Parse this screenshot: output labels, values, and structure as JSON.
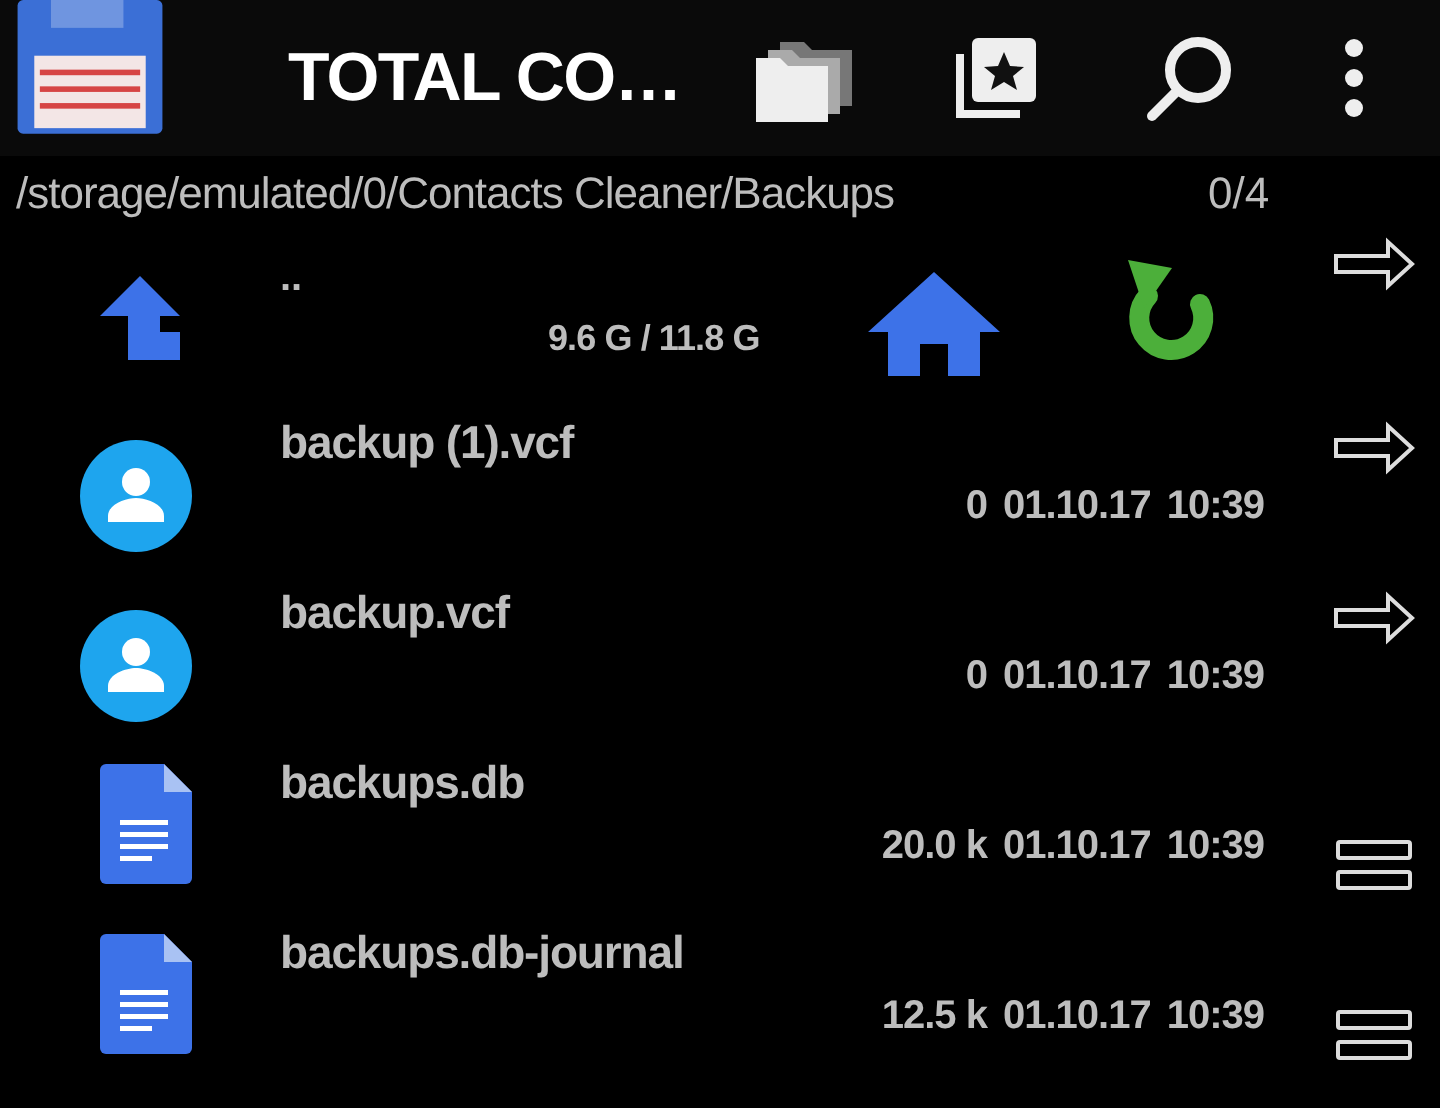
{
  "app_bar": {
    "title": "TOTAL CO…"
  },
  "path_bar": {
    "path": "/storage/emulated/0/Contacts Cleaner/Backups",
    "count": "0/4"
  },
  "parent_row": {
    "name": "..",
    "storage": "9.6 G / 11.8 G"
  },
  "files": [
    {
      "kind": "contact",
      "action": {
        "kind": "arrow"
      },
      "name": "backup (1).vcf",
      "size": "0",
      "date": "01.10.17",
      "time": "10:39"
    },
    {
      "kind": "contact",
      "action": {
        "kind": "arrow"
      },
      "name": "backup.vcf",
      "size": "0",
      "date": "01.10.17",
      "time": "10:39"
    },
    {
      "kind": "document",
      "action": {
        "kind": "lines"
      },
      "name": "backups.db",
      "size": "20.0 k",
      "date": "01.10.17",
      "time": "10:39"
    },
    {
      "kind": "document",
      "action": {
        "kind": "lines"
      },
      "name": "backups.db-journal",
      "size": "12.5 k",
      "date": "01.10.17",
      "time": "10:39"
    }
  ]
}
